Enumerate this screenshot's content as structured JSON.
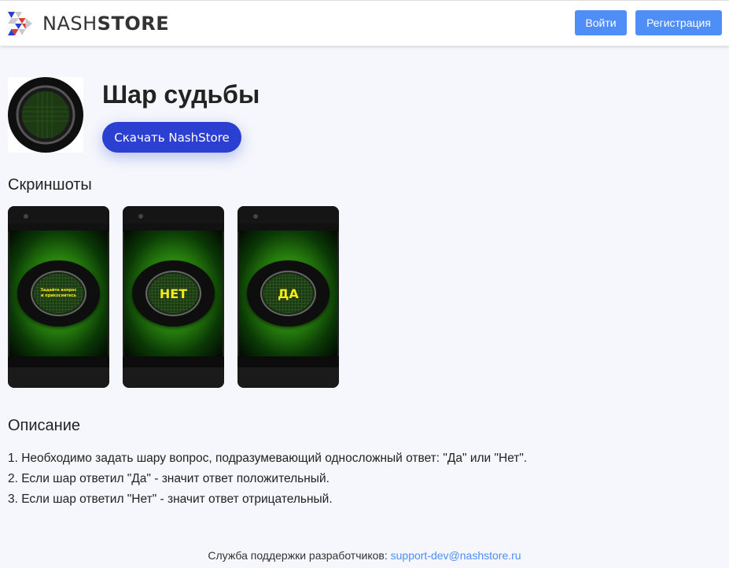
{
  "header": {
    "logo_light": "NASH",
    "logo_bold": "STORE",
    "login_label": "Войти",
    "register_label": "Регистрация"
  },
  "app": {
    "title": "Шар судьбы",
    "download_label": "Скачать NashStore"
  },
  "screenshots": {
    "title": "Скриншоты",
    "items": [
      {
        "ball_text": "Задайте вопрос\nи прикоснитесь"
      },
      {
        "ball_text": "НЕТ"
      },
      {
        "ball_text": "ДА"
      }
    ]
  },
  "description": {
    "title": "Описание",
    "lines": [
      "1. Необходимо задать шару вопрос, подразумевающий односложный ответ: \"Да\" или \"Нет\".",
      "2. Если шар ответил \"Да\" - значит ответ положительный.",
      "3. Если шар ответил \"Нет\" - значит ответ отрицательный."
    ]
  },
  "footer": {
    "label": "Служба поддержки разработчиков:",
    "email": "support-dev@nashstore.ru"
  },
  "colors": {
    "accent_blue": "#4f8ef7",
    "download_blue": "#2b3fd0",
    "ball_text": "#f4ea1a"
  }
}
